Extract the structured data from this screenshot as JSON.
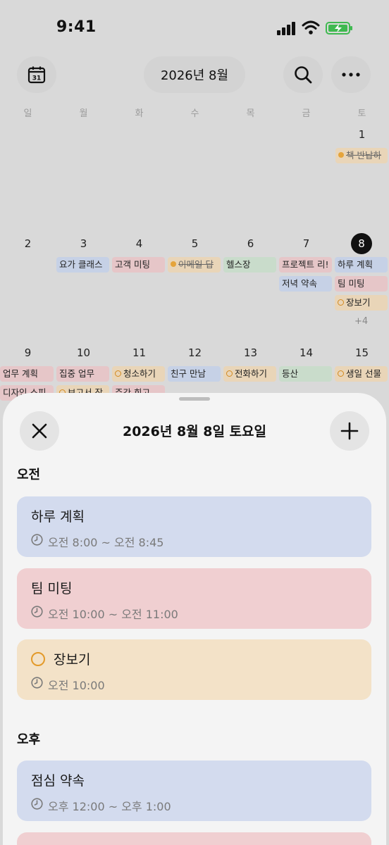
{
  "status_bar": {
    "time": "9:41"
  },
  "toolbar": {
    "month_label": "2026년 8월",
    "calendar_icon_day": "31"
  },
  "weekdays": [
    "일",
    "월",
    "화",
    "수",
    "목",
    "금",
    "토"
  ],
  "calendar": {
    "week1": {
      "day_sat": "1",
      "events": {
        "sat_1": "책 반납하"
      }
    },
    "week2": {
      "days": [
        "2",
        "3",
        "4",
        "5",
        "6",
        "7",
        "8"
      ],
      "events": {
        "mon_1": "요가 클래스",
        "tue_1": "고객 미팅",
        "wed_1": "이메일 답",
        "thu_1": "헬스장",
        "fri_1": "프로젝트 리!",
        "fri_2": "저녁 약속",
        "sat_1": "하루 계획",
        "sat_2": "팀 미팅",
        "sat_3": "장보기"
      },
      "more_count": "+4"
    },
    "week3": {
      "days": [
        "9",
        "10",
        "11",
        "12",
        "13",
        "14",
        "15"
      ],
      "events": {
        "sun_1": "업무 계획",
        "sun_2": "디자인 스피",
        "mon_1": "집중 업무",
        "mon_2": "보고서 작",
        "tue_1": "청소하기",
        "tue_2": "주간 회고",
        "wed_1": "친구 만남",
        "thu_1": "전화하기",
        "fri_1": "등산",
        "sat_1": "생일 선물"
      }
    }
  },
  "sheet": {
    "title": "2026년 8월 8일 토요일",
    "sections": {
      "am": "오전",
      "pm": "오후"
    },
    "cards": [
      {
        "title": "하루 계획",
        "time": "오전 8:00 ~ 오전 8:45"
      },
      {
        "title": "팀 미팅",
        "time": "오전 10:00 ~ 오전 11:00"
      },
      {
        "title": "장보기",
        "time": "오전 10:00"
      },
      {
        "title": "점심 약속",
        "time": "오후 12:00 ~ 오후 1:00"
      }
    ]
  },
  "colors": {
    "blue": "#d3dbee",
    "pink": "#f0cfd1",
    "orange": "#f3e2c8",
    "green": "#c9dccb"
  },
  "icons": [
    "calendar-icon",
    "search-icon",
    "more-icon",
    "close-icon",
    "plus-icon",
    "clock-icon",
    "signal-icon",
    "wifi-icon",
    "battery-icon"
  ]
}
